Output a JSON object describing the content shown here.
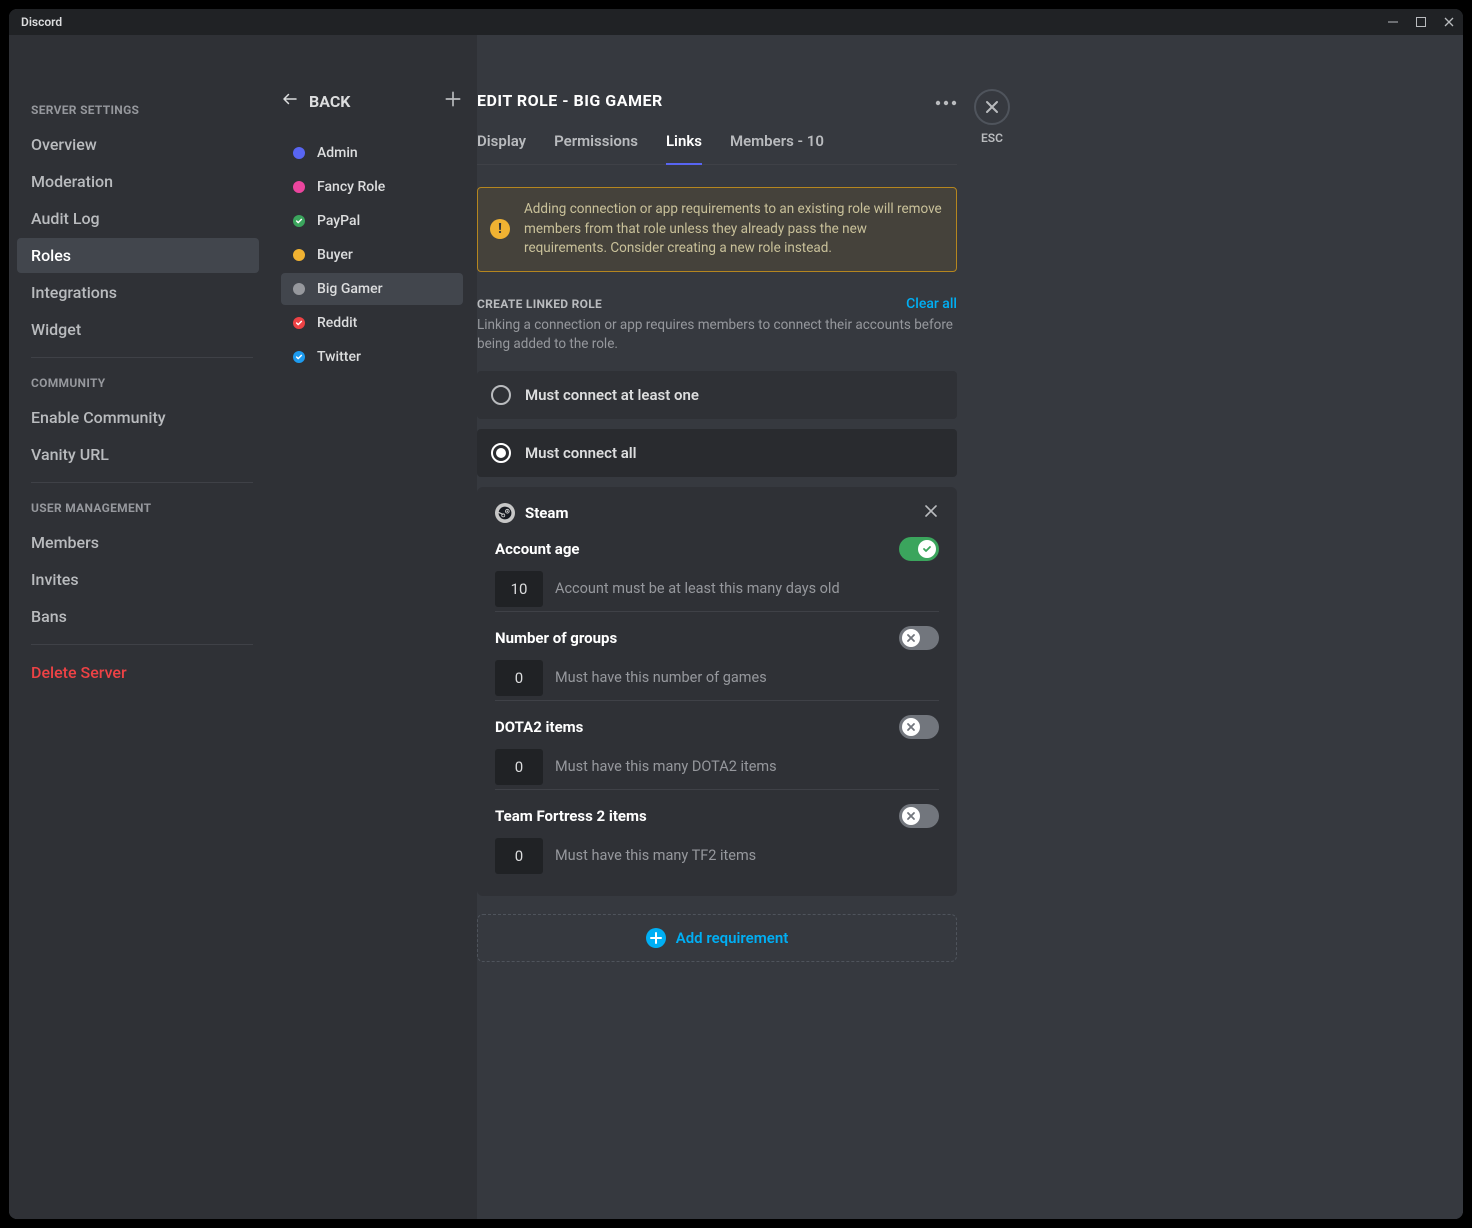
{
  "window": {
    "title": "Discord",
    "esc": "ESC"
  },
  "sidebar": {
    "heading_settings": "SERVER SETTINGS",
    "heading_community": "COMMUNITY",
    "heading_usermgmt": "USER MANAGEMENT",
    "items_settings": [
      "Overview",
      "Moderation",
      "Audit Log",
      "Roles",
      "Integrations",
      "Widget"
    ],
    "items_community": [
      "Enable Community",
      "Vanity URL"
    ],
    "items_usermgmt": [
      "Members",
      "Invites",
      "Bans"
    ],
    "active_index": 3,
    "delete": "Delete Server"
  },
  "roles_panel": {
    "back": "BACK",
    "roles": [
      {
        "name": "Admin",
        "color": "#5865f2",
        "check": false
      },
      {
        "name": "Fancy Role",
        "color": "#eb459e",
        "check": false
      },
      {
        "name": "PayPal",
        "color": "#3ba55d",
        "check": true
      },
      {
        "name": "Buyer",
        "color": "#f0b232",
        "check": false
      },
      {
        "name": "Big Gamer",
        "color": "#96989d",
        "check": false
      },
      {
        "name": "Reddit",
        "color": "#ed4245",
        "check": true
      },
      {
        "name": "Twitter",
        "color": "#1d9bf0",
        "check": true
      }
    ],
    "active_index": 4
  },
  "main": {
    "title_prefix": "EDIT ROLE  -  ",
    "role_name": "BIG GAMER",
    "tabs": [
      "Display",
      "Permissions",
      "Links",
      "Members - 10"
    ],
    "active_tab": 2,
    "warning": "Adding connection or app requirements to an existing role will remove members from that role unless they already pass the new requirements. Consider creating a new role instead.",
    "linked_head": "CREATE LINKED ROLE",
    "clear_all": "Clear all",
    "linked_desc": "Linking a connection or app requires members to connect their accounts before being added to the role.",
    "radio_one": "Must connect at least one",
    "radio_all": "Must connect all",
    "radio_selected": "all",
    "connection": {
      "name": "Steam",
      "requirements": [
        {
          "title": "Account age",
          "enabled": true,
          "value": "10",
          "desc": "Account must be at least this many days old"
        },
        {
          "title": "Number of groups",
          "enabled": false,
          "value": "0",
          "desc": "Must have this number of games"
        },
        {
          "title": "DOTA2 items",
          "enabled": false,
          "value": "0",
          "desc": "Must have this many DOTA2 items"
        },
        {
          "title": "Team Fortress 2 items",
          "enabled": false,
          "value": "0",
          "desc": "Must have this many TF2 items"
        }
      ]
    },
    "add_req": "Add requirement"
  }
}
